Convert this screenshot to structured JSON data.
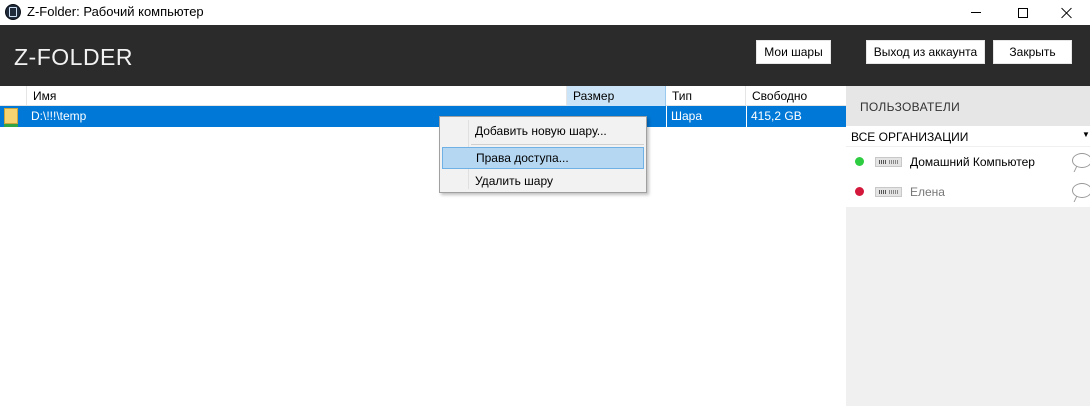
{
  "window": {
    "title": "Z-Folder: Рабочий компьютер"
  },
  "header": {
    "logo": "Z-FOLDER",
    "my_shares_label": "Мои шары",
    "logout_label": "Выход из аккаунта",
    "close_label": "Закрыть"
  },
  "table": {
    "columns": [
      "Имя",
      "Размер",
      "Тип",
      "Свободно"
    ],
    "sorted_column": "Размер",
    "rows": [
      {
        "name": "D:\\!!!\\temp",
        "size": "",
        "type": "Шара",
        "free": "415,2 GB",
        "icon": "folder-icon",
        "selected": true
      }
    ]
  },
  "context_menu": {
    "items": [
      "Добавить новую шару...",
      "Права доступа...",
      "Удалить шару"
    ],
    "highlighted": "Права доступа..."
  },
  "users_panel": {
    "title": "ПОЛЬЗОВАТЕЛИ",
    "org_filter": "ВСЕ ОРГАНИЗАЦИИ",
    "users": [
      {
        "name": "Домашний Компьютер",
        "status": "online",
        "status_color": "#2ecc40",
        "icon": "computer-icon"
      },
      {
        "name": "Елена",
        "status": "offline",
        "status_color": "#d3183c",
        "icon": "computer-icon"
      }
    ]
  },
  "colors": {
    "header_bg": "#2b2b2b",
    "selection": "#0078d7",
    "menu_highlight": "#b5d7f2"
  }
}
